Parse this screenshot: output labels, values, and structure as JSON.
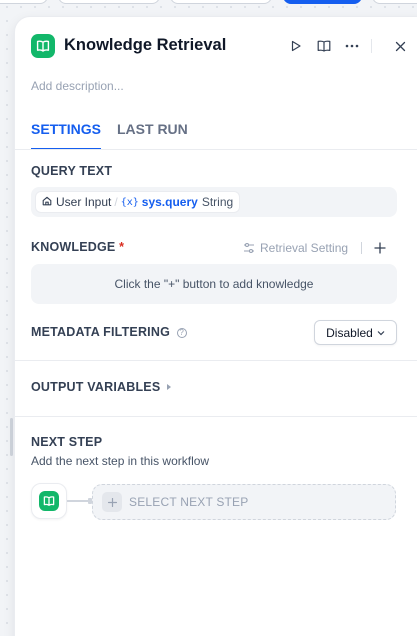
{
  "colors": {
    "accent": "#155eef",
    "node_green": "#12b76a",
    "required": "#d92d20"
  },
  "header": {
    "title": "Knowledge Retrieval",
    "icon": "book-icon",
    "actions": [
      "play-icon",
      "book-open-icon",
      "more-icon",
      "close-icon"
    ]
  },
  "description_placeholder": "Add description...",
  "tabs": [
    {
      "label": "SETTINGS",
      "active": true
    },
    {
      "label": "LAST RUN",
      "active": false
    }
  ],
  "query": {
    "label": "QUERY TEXT",
    "variable": {
      "node": "User Input",
      "separator": "/",
      "prefix": "{x}",
      "name": "sys.query",
      "type": "String"
    }
  },
  "knowledge": {
    "label": "KNOWLEDGE",
    "required_mark": "*",
    "retrieval_setting": "Retrieval Setting",
    "empty_text": "Click the \"+\" button to add knowledge"
  },
  "metadata": {
    "label": "METADATA FILTERING",
    "help": "?",
    "value": "Disabled"
  },
  "output": {
    "label": "OUTPUT VARIABLES"
  },
  "next_step": {
    "label": "NEXT STEP",
    "description": "Add the next step in this workflow",
    "select_label": "SELECT NEXT STEP"
  }
}
